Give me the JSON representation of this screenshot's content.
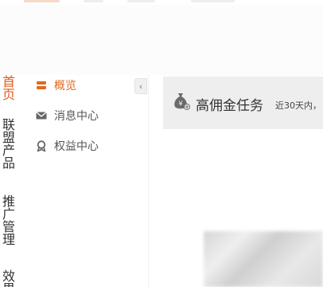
{
  "left_nav": {
    "items": [
      {
        "label": "首页",
        "active": true
      },
      {
        "label": "联盟产品",
        "active": false
      },
      {
        "label": "推广管理",
        "active": false
      },
      {
        "label": "效果报表",
        "active": false
      }
    ]
  },
  "sub_sidebar": {
    "items": [
      {
        "label": "概览",
        "icon": "dashboard-icon",
        "active": true
      },
      {
        "label": "消息中心",
        "icon": "mail-icon",
        "active": false
      },
      {
        "label": "权益中心",
        "icon": "badge-icon",
        "active": false
      }
    ],
    "collapse_glyph": "‹"
  },
  "content": {
    "title": "高佣金任务",
    "subtitle": "近30天内，"
  },
  "colors": {
    "accent": "#e0691e",
    "bar_bg": "#eeeeee"
  }
}
